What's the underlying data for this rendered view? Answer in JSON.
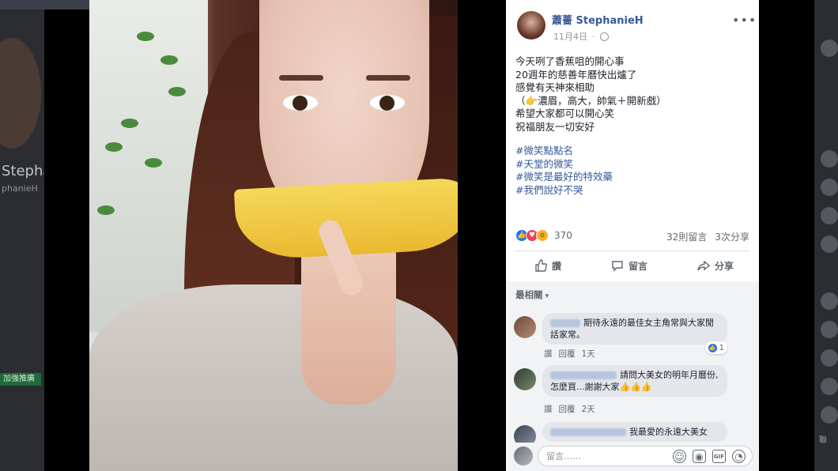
{
  "background": {
    "profile_name": "Stephar",
    "profile_handle": "phanieH",
    "left_button": "加強推廣",
    "right_label": "聯"
  },
  "post": {
    "author": "蕭薔 StephanieH",
    "date": "11月4日",
    "privacy_icon": "globe-icon",
    "more_icon": "ellipsis-icon",
    "lines": [
      "今天咧了香蕉咀的開心事",
      "20週年的慈善年曆快出爐了",
      "感覺有天神來相助",
      "（👉濃眉，高大，帥氣＋開新戲）",
      "希望大家都可以開心笑",
      "祝福朋友一切安好"
    ],
    "hashtags": [
      "#微笑點點名",
      "#天堂的微笑",
      "#微笑是最好的特效藥",
      "#我們說好不哭"
    ]
  },
  "reactions": {
    "count": "370",
    "types": [
      "like",
      "love",
      "wow"
    ],
    "comments": "32則留言",
    "shares": "3次分享"
  },
  "actions": {
    "like": "讚",
    "comment": "留言",
    "share": "分享"
  },
  "comments_section": {
    "sort_label": "最相關",
    "items": [
      {
        "text": "期待永遠的最佳女主角常與大家閒話家常。",
        "like_label": "讚",
        "reply_label": "回覆",
        "time": "1天",
        "like_count": "1"
      },
      {
        "text": "請問大美女的明年月曆份,怎麼買...謝謝大家👍👍👍",
        "like_label": "讚",
        "reply_label": "回覆",
        "time": "2天"
      },
      {
        "text": "我最愛的永遠大美女"
      }
    ]
  },
  "composer": {
    "placeholder": "留言……",
    "icons": [
      "emoji-icon",
      "camera-icon",
      "gif-icon",
      "sticker-icon"
    ]
  },
  "colors": {
    "link": "#365899",
    "author": "#385898",
    "like_blue": "#1877f2",
    "love_red": "#f33e58",
    "wow_yellow": "#f7b125"
  }
}
